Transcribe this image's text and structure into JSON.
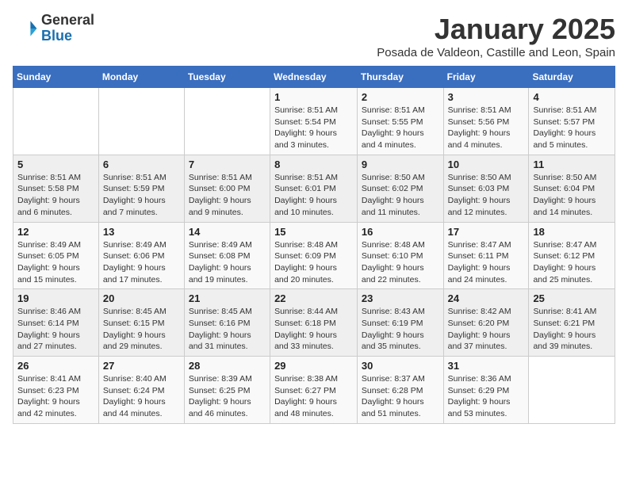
{
  "header": {
    "logo_general": "General",
    "logo_blue": "Blue",
    "month": "January 2025",
    "location": "Posada de Valdeon, Castille and Leon, Spain"
  },
  "weekdays": [
    "Sunday",
    "Monday",
    "Tuesday",
    "Wednesday",
    "Thursday",
    "Friday",
    "Saturday"
  ],
  "weeks": [
    [
      {
        "day": "",
        "info": ""
      },
      {
        "day": "",
        "info": ""
      },
      {
        "day": "",
        "info": ""
      },
      {
        "day": "1",
        "info": "Sunrise: 8:51 AM\nSunset: 5:54 PM\nDaylight: 9 hours and 3 minutes."
      },
      {
        "day": "2",
        "info": "Sunrise: 8:51 AM\nSunset: 5:55 PM\nDaylight: 9 hours and 4 minutes."
      },
      {
        "day": "3",
        "info": "Sunrise: 8:51 AM\nSunset: 5:56 PM\nDaylight: 9 hours and 4 minutes."
      },
      {
        "day": "4",
        "info": "Sunrise: 8:51 AM\nSunset: 5:57 PM\nDaylight: 9 hours and 5 minutes."
      }
    ],
    [
      {
        "day": "5",
        "info": "Sunrise: 8:51 AM\nSunset: 5:58 PM\nDaylight: 9 hours and 6 minutes."
      },
      {
        "day": "6",
        "info": "Sunrise: 8:51 AM\nSunset: 5:59 PM\nDaylight: 9 hours and 7 minutes."
      },
      {
        "day": "7",
        "info": "Sunrise: 8:51 AM\nSunset: 6:00 PM\nDaylight: 9 hours and 9 minutes."
      },
      {
        "day": "8",
        "info": "Sunrise: 8:51 AM\nSunset: 6:01 PM\nDaylight: 9 hours and 10 minutes."
      },
      {
        "day": "9",
        "info": "Sunrise: 8:50 AM\nSunset: 6:02 PM\nDaylight: 9 hours and 11 minutes."
      },
      {
        "day": "10",
        "info": "Sunrise: 8:50 AM\nSunset: 6:03 PM\nDaylight: 9 hours and 12 minutes."
      },
      {
        "day": "11",
        "info": "Sunrise: 8:50 AM\nSunset: 6:04 PM\nDaylight: 9 hours and 14 minutes."
      }
    ],
    [
      {
        "day": "12",
        "info": "Sunrise: 8:49 AM\nSunset: 6:05 PM\nDaylight: 9 hours and 15 minutes."
      },
      {
        "day": "13",
        "info": "Sunrise: 8:49 AM\nSunset: 6:06 PM\nDaylight: 9 hours and 17 minutes."
      },
      {
        "day": "14",
        "info": "Sunrise: 8:49 AM\nSunset: 6:08 PM\nDaylight: 9 hours and 19 minutes."
      },
      {
        "day": "15",
        "info": "Sunrise: 8:48 AM\nSunset: 6:09 PM\nDaylight: 9 hours and 20 minutes."
      },
      {
        "day": "16",
        "info": "Sunrise: 8:48 AM\nSunset: 6:10 PM\nDaylight: 9 hours and 22 minutes."
      },
      {
        "day": "17",
        "info": "Sunrise: 8:47 AM\nSunset: 6:11 PM\nDaylight: 9 hours and 24 minutes."
      },
      {
        "day": "18",
        "info": "Sunrise: 8:47 AM\nSunset: 6:12 PM\nDaylight: 9 hours and 25 minutes."
      }
    ],
    [
      {
        "day": "19",
        "info": "Sunrise: 8:46 AM\nSunset: 6:14 PM\nDaylight: 9 hours and 27 minutes."
      },
      {
        "day": "20",
        "info": "Sunrise: 8:45 AM\nSunset: 6:15 PM\nDaylight: 9 hours and 29 minutes."
      },
      {
        "day": "21",
        "info": "Sunrise: 8:45 AM\nSunset: 6:16 PM\nDaylight: 9 hours and 31 minutes."
      },
      {
        "day": "22",
        "info": "Sunrise: 8:44 AM\nSunset: 6:18 PM\nDaylight: 9 hours and 33 minutes."
      },
      {
        "day": "23",
        "info": "Sunrise: 8:43 AM\nSunset: 6:19 PM\nDaylight: 9 hours and 35 minutes."
      },
      {
        "day": "24",
        "info": "Sunrise: 8:42 AM\nSunset: 6:20 PM\nDaylight: 9 hours and 37 minutes."
      },
      {
        "day": "25",
        "info": "Sunrise: 8:41 AM\nSunset: 6:21 PM\nDaylight: 9 hours and 39 minutes."
      }
    ],
    [
      {
        "day": "26",
        "info": "Sunrise: 8:41 AM\nSunset: 6:23 PM\nDaylight: 9 hours and 42 minutes."
      },
      {
        "day": "27",
        "info": "Sunrise: 8:40 AM\nSunset: 6:24 PM\nDaylight: 9 hours and 44 minutes."
      },
      {
        "day": "28",
        "info": "Sunrise: 8:39 AM\nSunset: 6:25 PM\nDaylight: 9 hours and 46 minutes."
      },
      {
        "day": "29",
        "info": "Sunrise: 8:38 AM\nSunset: 6:27 PM\nDaylight: 9 hours and 48 minutes."
      },
      {
        "day": "30",
        "info": "Sunrise: 8:37 AM\nSunset: 6:28 PM\nDaylight: 9 hours and 51 minutes."
      },
      {
        "day": "31",
        "info": "Sunrise: 8:36 AM\nSunset: 6:29 PM\nDaylight: 9 hours and 53 minutes."
      },
      {
        "day": "",
        "info": ""
      }
    ]
  ]
}
